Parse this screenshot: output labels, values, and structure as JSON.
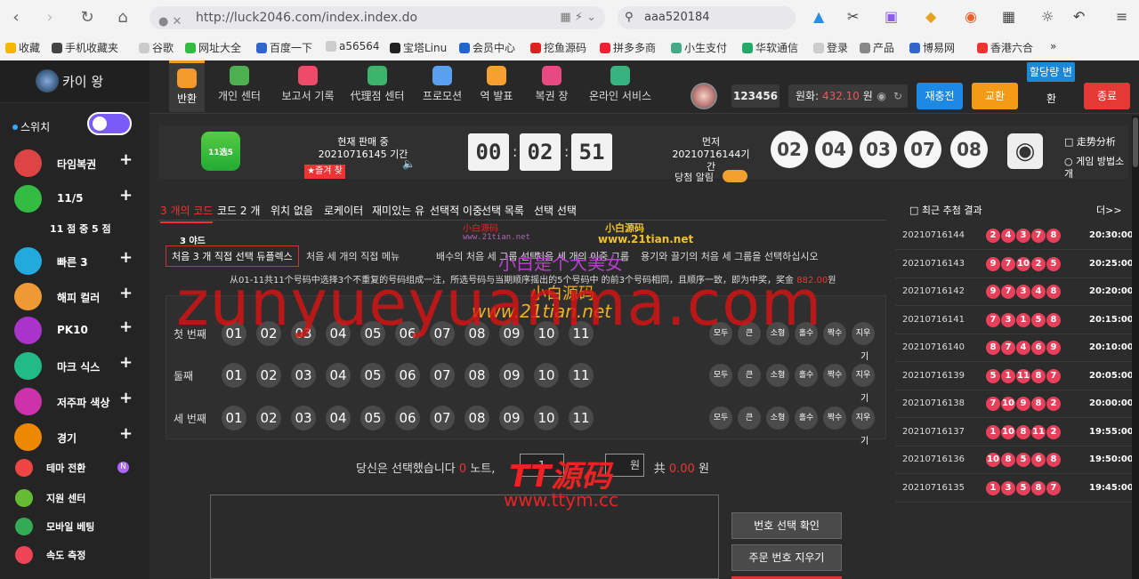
{
  "browser": {
    "url": "http://luck2046.com/index.index.do",
    "search": "aaa520184",
    "bookmarks": [
      "收藏",
      "手机收藏夹",
      "谷歌",
      "网址大全",
      "百度一下",
      "a56564",
      "宝塔Linu",
      "会员中心",
      "挖鱼源码",
      "拼多多商",
      "小生支付",
      "华软通信",
      "登录",
      "产品",
      "博易网",
      "香港六合",
      "»"
    ]
  },
  "sidebar": {
    "brand": "카이 왕",
    "switch_label": "스위치",
    "items": [
      {
        "label": "타임복권",
        "icon": "time-lottery-icon",
        "color": "#d44"
      },
      {
        "label": "11/5",
        "icon": "eleven-five-icon",
        "color": "#3b4"
      },
      {
        "label": "빠른 3",
        "icon": "fast-three-icon",
        "color": "#2ad"
      },
      {
        "label": "해피 컬러",
        "icon": "happy-color-icon",
        "color": "#e93"
      },
      {
        "label": "PK10",
        "icon": "pk10-icon",
        "color": "#a3c"
      },
      {
        "label": "마크 식스",
        "icon": "mark-six-icon",
        "color": "#2b8"
      },
      {
        "label": "저주파 색상",
        "icon": "low-freq-color-icon",
        "color": "#c3a"
      },
      {
        "label": "경기",
        "icon": "sports-icon",
        "color": "#e80"
      }
    ],
    "sub_label": "11 점 중 5 점",
    "bottom": [
      {
        "label": "테마 전환",
        "icon": "theme-icon",
        "color": "#e44"
      },
      {
        "label": "지원 센터",
        "icon": "support-icon",
        "color": "#6b3"
      },
      {
        "label": "모바일 베팅",
        "icon": "mobile-icon",
        "color": "#3a5"
      },
      {
        "label": "속도 측정",
        "icon": "speed-icon",
        "color": "#e45"
      }
    ],
    "theme_badge": "N"
  },
  "topnav": {
    "items": [
      {
        "label": "반환",
        "color": "#f39a2b"
      },
      {
        "label": "개인 센터",
        "color": "#4cb050"
      },
      {
        "label": "보고서 기록",
        "color": "#ee4b6a"
      },
      {
        "label": "代理점 센터",
        "color": "#3bb46c"
      },
      {
        "label": "프로모션",
        "color": "#5aa0f0"
      },
      {
        "label": "역 발표",
        "color": "#f5a030"
      },
      {
        "label": "복권 장",
        "color": "#e64a80"
      },
      {
        "label": "온라인 서비스",
        "color": "#36b37e"
      }
    ],
    "user_id": "123456",
    "balance_label": "원화:",
    "balance_value": "432.10",
    "balance_unit": "원",
    "recharge": "재충전",
    "exchange": "교환",
    "lang_label": "할당량 변",
    "lang_sub": "환",
    "logout": "종료"
  },
  "game": {
    "logo_text": "11选5",
    "current_label": "현재 판매 중20210716145 기간",
    "favorite": "★즐겨 찾",
    "countdown": [
      "00",
      "02",
      "51"
    ],
    "prev_label": "먼저 20210716144기 간",
    "draw_label": "당첨 알림",
    "winning_numbers": [
      "02",
      "04",
      "03",
      "07",
      "08"
    ],
    "trend": "走势分析",
    "method": "게임 방법소 개"
  },
  "play": {
    "tabs": [
      "3 개의 코드",
      "코드 2 개",
      "위치 없음",
      "로케이터",
      "재미있는 유",
      "선택적 이중",
      "선택 목록",
      "선택 선택"
    ],
    "yard": "3 야드",
    "subtabs": [
      "처음 3 개 직접 선택 듀플렉스",
      "처음 세 개의 직접 메뉴",
      "배수의 처음 세 그룹 선택",
      "처음 세 개의 이중 그룹",
      "용기와 끌기의 처음 세 그룹을 선택하십시오"
    ],
    "description_text": "从01-11共11个号码中选择3个不重复的号码组成一注，所选号码与当期顺序摇出的5个号码中 的前3个号码相同，且顺序一致，即为中奖，奖金",
    "prize": "882.00",
    "prize_unit": "원",
    "rows": [
      "첫 번째",
      "둘째",
      "세 번째"
    ],
    "numbers": [
      "01",
      "02",
      "03",
      "04",
      "05",
      "06",
      "07",
      "08",
      "09",
      "10",
      "11"
    ],
    "quick": [
      "모두",
      "큰",
      "소형",
      "홀수",
      "짝수",
      "지우"
    ],
    "quick_tail": "기",
    "bet_text1": "당신은 선택했습니다",
    "bet_notes": "0",
    "bet_text2": "노트,",
    "bet_multiplier": "1",
    "bet_unit": "원",
    "bet_total_label": "共",
    "bet_total": "0.00",
    "bet_total_unit": "원",
    "confirm_btn": "번호 선택 확인",
    "clear_btn": "주문 번호 지우기"
  },
  "results": {
    "title": "최근 추첨 결과",
    "more": "더>>",
    "rows": [
      {
        "id": "20210716144",
        "nums": [
          "2",
          "4",
          "3",
          "7",
          "8"
        ],
        "time": "20:30:00"
      },
      {
        "id": "20210716143",
        "nums": [
          "9",
          "7",
          "10",
          "2",
          "5"
        ],
        "time": "20:25:00"
      },
      {
        "id": "20210716142",
        "nums": [
          "9",
          "7",
          "3",
          "4",
          "8"
        ],
        "time": "20:20:00"
      },
      {
        "id": "20210716141",
        "nums": [
          "7",
          "3",
          "1",
          "5",
          "8"
        ],
        "time": "20:15:00"
      },
      {
        "id": "20210716140",
        "nums": [
          "8",
          "7",
          "4",
          "6",
          "9"
        ],
        "time": "20:10:00"
      },
      {
        "id": "20210716139",
        "nums": [
          "5",
          "1",
          "11",
          "8",
          "7"
        ],
        "time": "20:05:00"
      },
      {
        "id": "20210716138",
        "nums": [
          "7",
          "10",
          "9",
          "8",
          "2"
        ],
        "time": "20:00:00"
      },
      {
        "id": "20210716137",
        "nums": [
          "1",
          "10",
          "8",
          "11",
          "2"
        ],
        "time": "19:55:00"
      },
      {
        "id": "20210716136",
        "nums": [
          "10",
          "8",
          "5",
          "6",
          "8"
        ],
        "time": "19:50:00"
      },
      {
        "id": "20210716135",
        "nums": [
          "1",
          "3",
          "5",
          "8",
          "7"
        ],
        "time": "19:45:00"
      }
    ]
  },
  "watermarks": {
    "big": "zunyueyuanma.com",
    "xb1": "小白源码",
    "xb_url": "www.21tian.net",
    "xb2": "小白是个大美女",
    "xb3": "小白源码",
    "xb_url2": "www.21tian.net",
    "xb4": "小白源码",
    "xb_url3": "www.21tian.net",
    "tt": "TT源码",
    "tt_url": "www.ttym.cc"
  }
}
